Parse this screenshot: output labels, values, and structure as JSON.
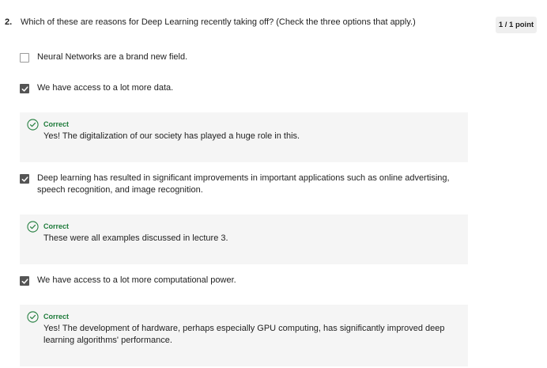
{
  "question": {
    "number": "2.",
    "text": "Which of these are reasons for Deep Learning recently taking off? (Check the three options that apply.)",
    "points": "1 / 1 point"
  },
  "options": [
    {
      "label": "Neural Networks are a brand new field.",
      "checked": false
    },
    {
      "label": "We have access to a lot more data.",
      "checked": true,
      "feedback": {
        "status": "Correct",
        "text": "Yes! The digitalization of our society has played a huge role in this."
      }
    },
    {
      "label": "Deep learning has resulted in significant improvements in important applications such as online advertising, speech recognition, and image recognition.",
      "checked": true,
      "feedback": {
        "status": "Correct",
        "text": "These were all examples discussed in lecture 3."
      }
    },
    {
      "label": "We have access to a lot more computational power.",
      "checked": true,
      "feedback": {
        "status": "Correct",
        "text": "Yes! The development of hardware, perhaps especially GPU computing, has significantly improved deep learning algorithms' performance."
      }
    }
  ],
  "colors": {
    "correct": "#1e7b3a",
    "feedback_bg": "#f5f5f5",
    "checkbox_checked": "#555555"
  }
}
